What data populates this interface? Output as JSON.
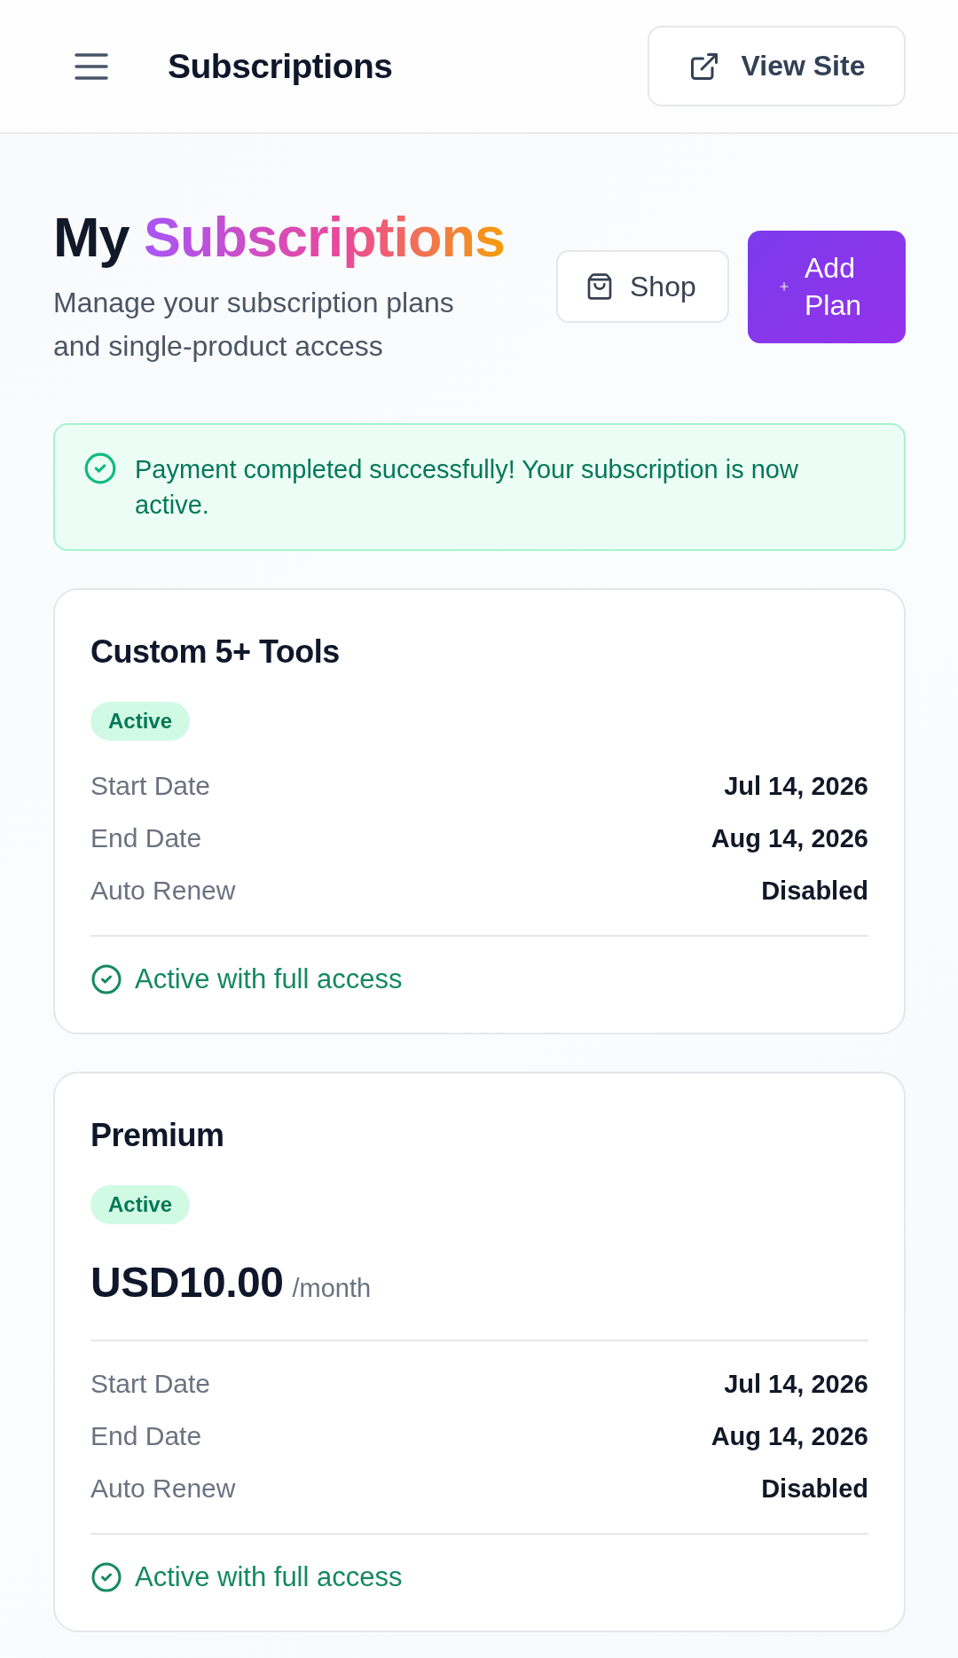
{
  "header": {
    "title": "Subscriptions",
    "view_site_button": "View Site"
  },
  "hero": {
    "title": "My",
    "title_highlight": "Subscriptions",
    "subtitle": "Manage your subscription plans and single-product access",
    "buttons": [
      {
        "label": "Shop",
        "kind": "outline"
      },
      {
        "label": "Add Plan",
        "kind": "primary"
      }
    ]
  },
  "alert": {
    "kind": "success",
    "message": "Payment completed successfully! Your subscription is now active."
  },
  "subscriptions": [
    {
      "name": "Custom 5+ Tools",
      "status": "Active",
      "details": [
        {
          "label": "Start Date",
          "value": "Jul 14, 2026"
        },
        {
          "label": "End Date",
          "value": "Aug 14, 2026"
        },
        {
          "label": "Auto Renew",
          "value": "Disabled"
        }
      ],
      "footer": "Active with full access"
    },
    {
      "name": "Premium",
      "status": "Active",
      "price": "USD10.00",
      "period": "/month",
      "details": [
        {
          "label": "Start Date",
          "value": "Jul 14, 2026"
        },
        {
          "label": "End Date",
          "value": "Aug 14, 2026"
        },
        {
          "label": "Auto Renew",
          "value": "Disabled"
        }
      ],
      "footer": "Active with full access"
    }
  ]
}
